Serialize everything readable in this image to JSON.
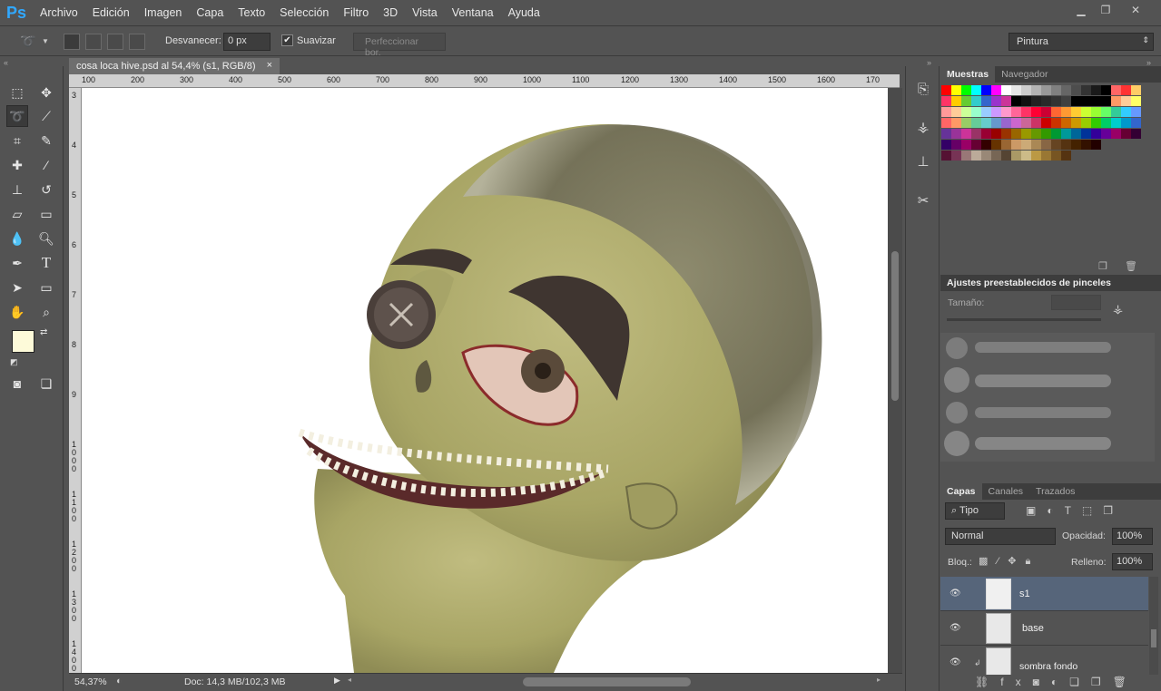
{
  "app": {
    "logo": "Ps"
  },
  "menu": [
    "Archivo",
    "Edición",
    "Imagen",
    "Capa",
    "Texto",
    "Selección",
    "Filtro",
    "3D",
    "Vista",
    "Ventana",
    "Ayuda"
  ],
  "options": {
    "feather_label": "Desvanecer:",
    "feather_value": "0 px",
    "smooth_label": "Suavizar",
    "refine_label": "Perfeccionar bor.",
    "workspace": "Pintura"
  },
  "document": {
    "tab_title": "cosa loca hive.psd al 54,4% (s1, RGB/8)",
    "close_glyph": "×"
  },
  "ruler": {
    "top": [
      "100",
      "200",
      "300",
      "400",
      "500",
      "600",
      "700",
      "800",
      "900",
      "1000",
      "1100",
      "1200",
      "1300",
      "1400",
      "1500",
      "1600",
      "170"
    ],
    "left": [
      "3",
      "4",
      "5",
      "6",
      "7",
      "8",
      "9",
      "1 0 0 0",
      "1 1 0 0",
      "1 2 0 0",
      "1 3 0 0",
      "1 4 0 0"
    ]
  },
  "status": {
    "zoom": "54,37%",
    "doc": "Doc: 14,3 MB/102,3 MB"
  },
  "swatches_panel": {
    "tabs": [
      "Muestras",
      "Navegador"
    ]
  },
  "brush_presets": {
    "title": "Ajustes preestablecidos de pinceles",
    "size_label": "Tamaño:"
  },
  "layers_panel": {
    "tabs": [
      "Capas",
      "Canales",
      "Trazados"
    ],
    "filter_kind": "Tipo",
    "blend_mode": "Normal",
    "opacity_label": "Opacidad:",
    "opacity_value": "100%",
    "lock_label": "Bloq.:",
    "fill_label": "Relleno:",
    "fill_value": "100%",
    "layers": [
      {
        "name": "s1",
        "selected": true
      },
      {
        "name": "base",
        "selected": false
      },
      {
        "name": "sombra fondo",
        "selected": false
      }
    ]
  },
  "colors": {
    "foreground": "#fdfad9",
    "background": "#9a8f63",
    "swatches": [
      [
        "#ff0000",
        "#ffff00",
        "#00ff00",
        "#00ffff",
        "#0000ff",
        "#ff00ff",
        "#ffffff",
        "#e6e6e6",
        "#cccccc",
        "#b3b3b3",
        "#999999",
        "#808080",
        "#666666",
        "#4d4d4d",
        "#333333",
        "#1a1a1a",
        "#000000",
        "#ff6666",
        "#ff3333",
        "#ffcc66"
      ],
      [
        "#ff3366",
        "#ffcc00",
        "#66cc33",
        "#33cccc",
        "#3366cc",
        "#9933cc",
        "#cc3399",
        "#000000",
        "#111111",
        "#222222",
        "#2a2a2a",
        "#333333",
        "#404040",
        "#000000",
        "#000000",
        "#000000",
        "#000000",
        "#ff9966",
        "#ffcc99",
        "#ffff66"
      ],
      [
        "#ff9999",
        "#ffcc99",
        "#ccff99",
        "#99ffcc",
        "#99ccff",
        "#cc99ff",
        "#ff99cc",
        "#ff6699",
        "#ff3366",
        "#ff0033",
        "#cc0033",
        "#ff6633",
        "#ff9933",
        "#ffcc33",
        "#ccff33",
        "#99ff33",
        "#66ff66",
        "#33cc99",
        "#33ccff",
        "#6699ff"
      ],
      [
        "#ff6666",
        "#ff9966",
        "#99cc66",
        "#66cc99",
        "#66cccc",
        "#6699cc",
        "#9966cc",
        "#cc66cc",
        "#cc6699",
        "#cc3366",
        "#cc0000",
        "#cc3300",
        "#cc6600",
        "#cc9900",
        "#99cc00",
        "#33cc00",
        "#00cc66",
        "#00cccc",
        "#0099cc",
        "#3366cc"
      ],
      [
        "#663399",
        "#993399",
        "#cc3399",
        "#993366",
        "#990033",
        "#990000",
        "#993300",
        "#996600",
        "#999900",
        "#669900",
        "#339900",
        "#009933",
        "#009999",
        "#006699",
        "#003399",
        "#330099",
        "#660099",
        "#990066",
        "#660033",
        "#330033"
      ],
      [
        "#330066",
        "#660066",
        "#990066",
        "#660033",
        "#330000",
        "#663300",
        "#996633",
        "#cc9966",
        "#ccaa77",
        "#aa8855",
        "#886644",
        "#664422",
        "#553311",
        "#442200",
        "#331100",
        "#220000"
      ],
      [
        "#551133",
        "#773355",
        "#997777",
        "#bbaa99",
        "#998877",
        "#776655",
        "#554433",
        "#aa9966",
        "#ccbb88",
        "#bb9944",
        "#997733",
        "#775522",
        "#553311"
      ]
    ]
  }
}
